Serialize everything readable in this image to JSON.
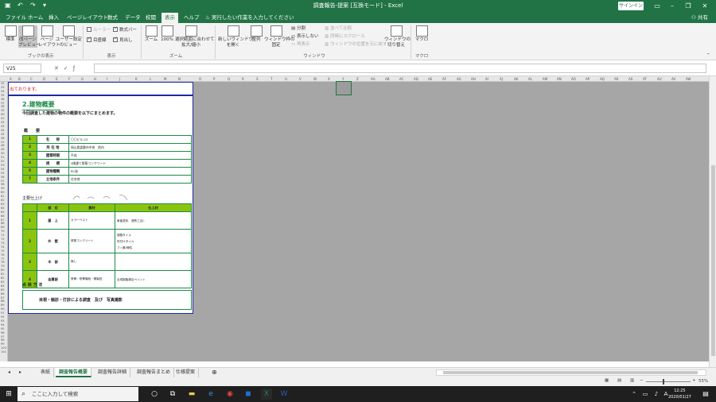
{
  "window": {
    "title": "調査報告-提案 [互換モード] - Excel",
    "sign_in": "サインイン",
    "quick_access_icons": [
      "save-icon",
      "undo-icon",
      "redo-icon",
      "customize-icon"
    ]
  },
  "ribbon": {
    "tabs": [
      "ファイル",
      "ホーム",
      "挿入",
      "ページレイアウト",
      "数式",
      "データ",
      "校閲",
      "表示",
      "ヘルプ"
    ],
    "active_tab": "表示",
    "tell_me": "実行したい作業を入力してください",
    "share": "共有",
    "groups": {
      "workbook_views": {
        "name": "ブックの表示",
        "buttons": [
          "標準",
          "改ページ\nプレビュー",
          "ページ\nレイアウト",
          "ユーザー設定\nのビュー"
        ]
      },
      "show": {
        "name": "表示",
        "ruler": "ルーラー",
        "formula_bar": "数式バー",
        "gridlines": "目盛線",
        "headings": "見出し"
      },
      "zoom": {
        "name": "ズーム",
        "buttons": [
          "ズーム",
          "100%",
          "選択範囲に合わせて\n拡大/縮小"
        ]
      },
      "window": {
        "name": "ウィンドウ",
        "buttons": [
          "新しいウィンドウ\nを開く",
          "整列",
          "ウィンドウ枠の\n固定"
        ],
        "small": [
          "分割",
          "表示しない",
          "再表示"
        ],
        "dim": [
          "並べて比較",
          "同時にスクロール",
          "ウィンドウの位置を元に戻す"
        ],
        "switch": "ウィンドウの\n切り替え"
      },
      "macro": {
        "name": "マクロ",
        "button": "マクロ"
      }
    }
  },
  "formula_bar": {
    "name_box": "V25",
    "value": ""
  },
  "sheet": {
    "note": "出ております。",
    "section_title": "2.建物概要",
    "intro": "今回調査した建物の物件の概要を以下にまとめます。",
    "overview_heading": "概　　要",
    "spec_rows": [
      {
        "no": "1",
        "label": "名　　称",
        "value": "〇〇ビル-22"
      },
      {
        "no": "2",
        "label": "所 在 地",
        "value": "岡山県倉敷市中央　他内"
      },
      {
        "no": "3",
        "label": "建築時期",
        "value": "平成"
      },
      {
        "no": "4",
        "label": "規　　模",
        "value": "4階建て鉄筋コンクリート"
      },
      {
        "no": "5",
        "label": "建物種類",
        "value": "RC造"
      },
      {
        "no": "7",
        "label": "立地条件",
        "value": "住宅地"
      }
    ],
    "finish_heading": "主要仕上げ",
    "finish_headers": [
      "部　位",
      "素材",
      "仕上材"
    ],
    "finish_rows": [
      {
        "no": "1",
        "part": "屋　上",
        "material": "カラーベスト",
        "finish": "東亜塗料　遮熱工法/-"
      },
      {
        "no": "2",
        "part": "外　壁",
        "material": "鉄筋コンクリート",
        "finish": "調整タイル\n吹付けタイル\nフッ素/弾性"
      },
      {
        "no": "3",
        "part": "木　部",
        "material": "無し",
        "finish": ""
      },
      {
        "no": "4",
        "part": "金属部",
        "material": "鉄骨・鉄骨階段・鋼製庇",
        "finish": "合成樹脂調合ペイント"
      }
    ],
    "inspection_heading": "点 検 方 法",
    "inspection_text": "目視・触診・打診による調査　及び　写真撮影"
  },
  "sheet_tabs": [
    "表紙",
    "調査報告概要",
    "調査報告詳細",
    "調査報告まとめ",
    "仕様提案"
  ],
  "active_sheet": "調査報告概要",
  "status": {
    "zoom_level": "55%"
  },
  "taskbar": {
    "search_placeholder": "ここに入力して検索",
    "time": "12:25",
    "date": "2020/01/27"
  },
  "colors": {
    "excel_green": "#217346",
    "table_green": "#1e8a4a",
    "header_fill": "#8bc40e",
    "page_frame": "#1f2a9c",
    "note_red": "#e02020"
  }
}
